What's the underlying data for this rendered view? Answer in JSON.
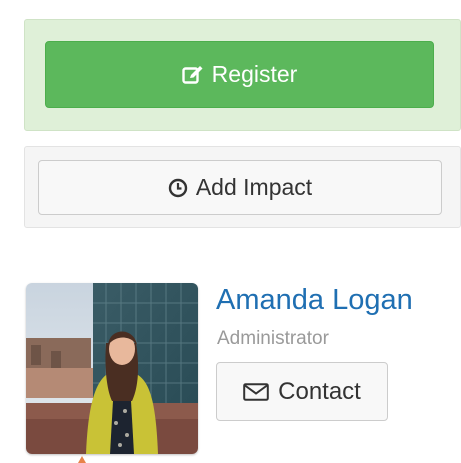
{
  "register": {
    "label": "Register",
    "icon": "edit-icon",
    "color": "#5cb85c"
  },
  "impact": {
    "label": "Add Impact",
    "icon": "clock-icon"
  },
  "profile": {
    "name": "Amanda Logan",
    "role": "Administrator",
    "name_color": "#1f6fb2",
    "photo": "profile-photo"
  },
  "contact": {
    "label": "Contact",
    "icon": "envelope-icon"
  }
}
